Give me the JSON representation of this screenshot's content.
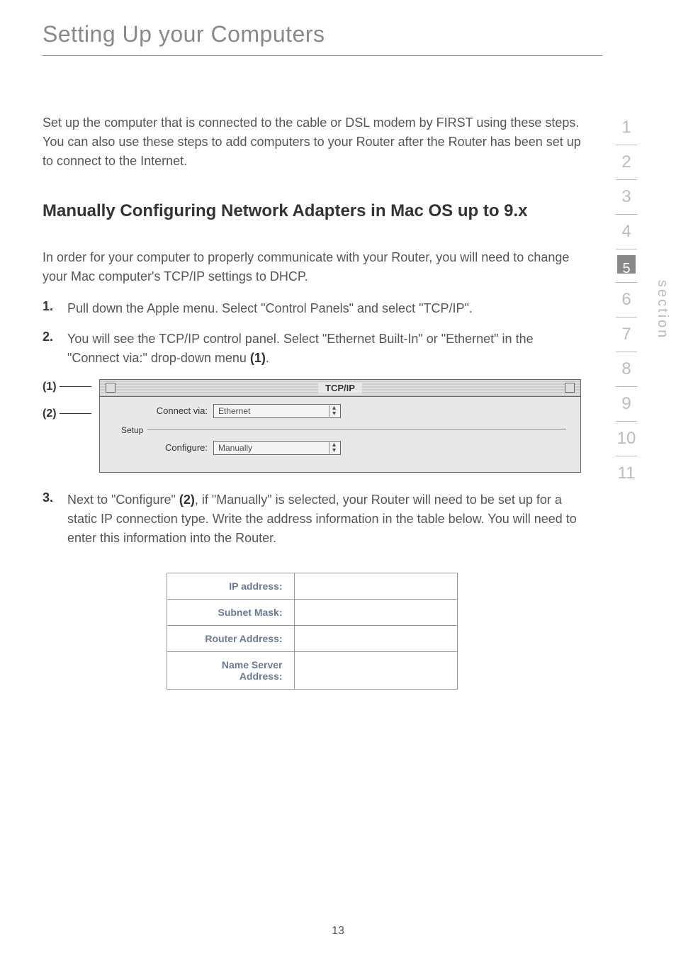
{
  "header": "Setting Up your Computers",
  "intro": "Set up the computer that is connected to the cable or DSL modem by FIRST using these steps. You can also use these steps to add computers to your Router after the Router has been set up to connect to the Internet.",
  "sectionHeading": "Manually Configuring Network Adapters in Mac OS up to 9.x",
  "preamble": "In order for your computer to properly communicate with your Router, you will need to change your Mac computer's TCP/IP settings to DHCP.",
  "steps": [
    {
      "num": "1.",
      "text": "Pull down the Apple menu. Select \"Control Panels\" and select \"TCP/IP\"."
    },
    {
      "num": "2.",
      "text_before": "You will see the TCP/IP control panel. Select \"Ethernet Built-In\" or \"Ethernet\" in the \"Connect via:\" drop-down menu ",
      "ref": "(1)",
      "text_after": "."
    },
    {
      "num": "3.",
      "text_before": "Next to \"Configure\" ",
      "ref": "(2)",
      "text_after": ", if \"Manually\" is selected, your Router will need to be set up for a static IP connection type. Write the address information in the table below. You will need to enter this information into the Router."
    }
  ],
  "callouts": {
    "one": "(1)",
    "two": "(2)"
  },
  "tcpip": {
    "title": "TCP/IP",
    "connectViaLabel": "Connect via:",
    "connectViaValue": "Ethernet",
    "setupLabel": "Setup",
    "configureLabel": "Configure:",
    "configureValue": "Manually"
  },
  "addrTable": {
    "ip": "IP address:",
    "subnet": "Subnet Mask:",
    "router": "Router Address:",
    "nameServer": "Name Server Address:"
  },
  "nav": {
    "items": [
      "1",
      "2",
      "3",
      "4",
      "5",
      "6",
      "7",
      "8",
      "9",
      "10",
      "11"
    ],
    "active": "5",
    "label": "section"
  },
  "pageNum": "13"
}
